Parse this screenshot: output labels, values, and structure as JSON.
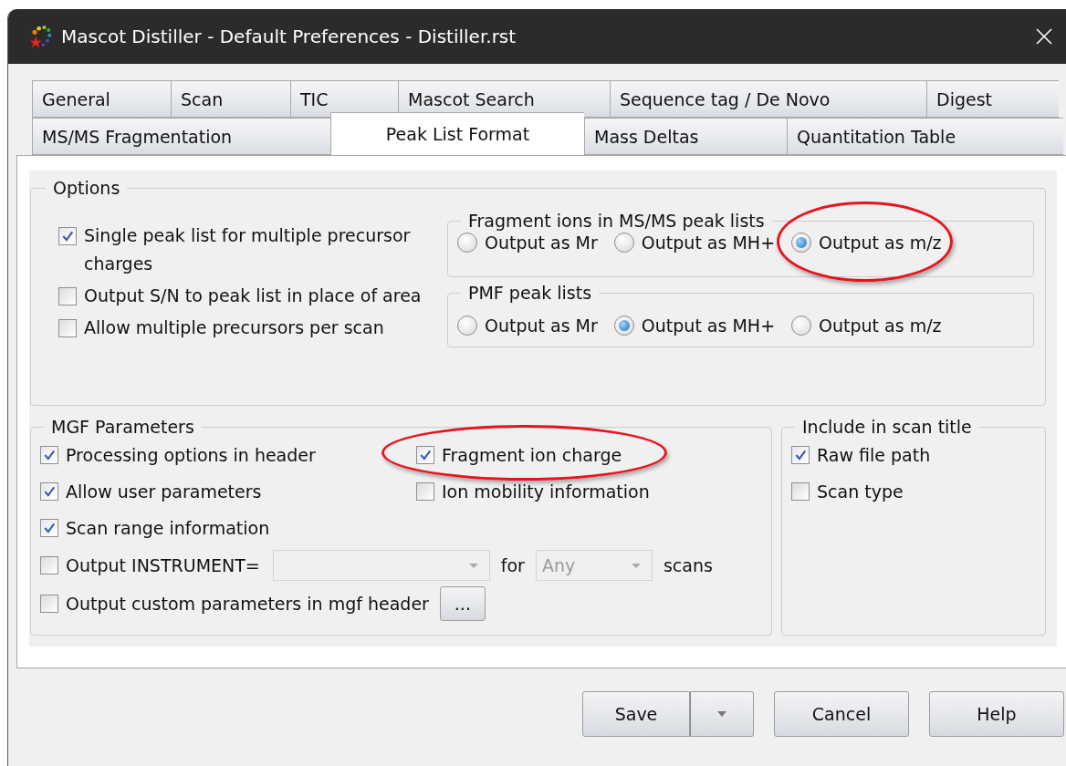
{
  "window": {
    "title": "Mascot Distiller - Default Preferences - Distiller.rst"
  },
  "tab_rows": [
    {
      "tabs": [
        {
          "label": "General",
          "selected": false
        },
        {
          "label": "Scan",
          "selected": false
        },
        {
          "label": "TIC",
          "selected": false
        },
        {
          "label": "Mascot Search",
          "selected": false
        },
        {
          "label": "Sequence tag / De Novo",
          "selected": false
        },
        {
          "label": "Digest",
          "selected": false
        }
      ]
    },
    {
      "tabs": [
        {
          "label": "MS/MS Fragmentation",
          "selected": false
        },
        {
          "label": "Peak List Format",
          "selected": true
        },
        {
          "label": "Mass Deltas",
          "selected": false
        },
        {
          "label": "Quantitation Table",
          "selected": false
        }
      ]
    }
  ],
  "options": {
    "title": "Options",
    "checkboxes": [
      {
        "label": "Single peak list for multiple precursor charges",
        "checked": true
      },
      {
        "label": "Output S/N to peak list in place of area",
        "checked": false
      },
      {
        "label": "Allow multiple precursors per scan",
        "checked": false
      }
    ],
    "groups": [
      {
        "title": "Fragment ions in MS/MS peak lists",
        "options": [
          {
            "label": "Output as Mr",
            "selected": false,
            "highlighted": false
          },
          {
            "label": "Output as MH+",
            "selected": false,
            "highlighted": false
          },
          {
            "label": "Output as m/z",
            "selected": true,
            "highlighted": true
          }
        ]
      },
      {
        "title": "PMF peak lists",
        "options": [
          {
            "label": "Output as Mr",
            "selected": false,
            "highlighted": false
          },
          {
            "label": "Output as MH+",
            "selected": true,
            "highlighted": false
          },
          {
            "label": "Output as m/z",
            "selected": false,
            "highlighted": false
          }
        ]
      }
    ]
  },
  "mgf": {
    "title": "MGF Parameters",
    "left": [
      {
        "label": "Processing options in header",
        "checked": true,
        "highlighted": false
      },
      {
        "label": "Allow user parameters",
        "checked": true,
        "highlighted": false
      },
      {
        "label": "Scan range information",
        "checked": true,
        "highlighted": false
      }
    ],
    "right": [
      {
        "label": "Fragment ion charge",
        "checked": true,
        "highlighted": true
      },
      {
        "label": "Ion mobility information",
        "checked": false,
        "highlighted": false
      }
    ],
    "instrument": {
      "label": "Output INSTRUMENT=",
      "checked": false,
      "for_label": "for",
      "scan_combo": "Any",
      "suffix": "scans"
    },
    "custom": {
      "label": "Output custom parameters in mgf header",
      "checked": false,
      "button": "..."
    }
  },
  "scan_title": {
    "title": "Include in scan title",
    "checkboxes": [
      {
        "label": "Raw file path",
        "checked": true
      },
      {
        "label": "Scan type",
        "checked": false
      }
    ]
  },
  "buttons": {
    "save": "Save",
    "cancel": "Cancel",
    "help": "Help"
  }
}
